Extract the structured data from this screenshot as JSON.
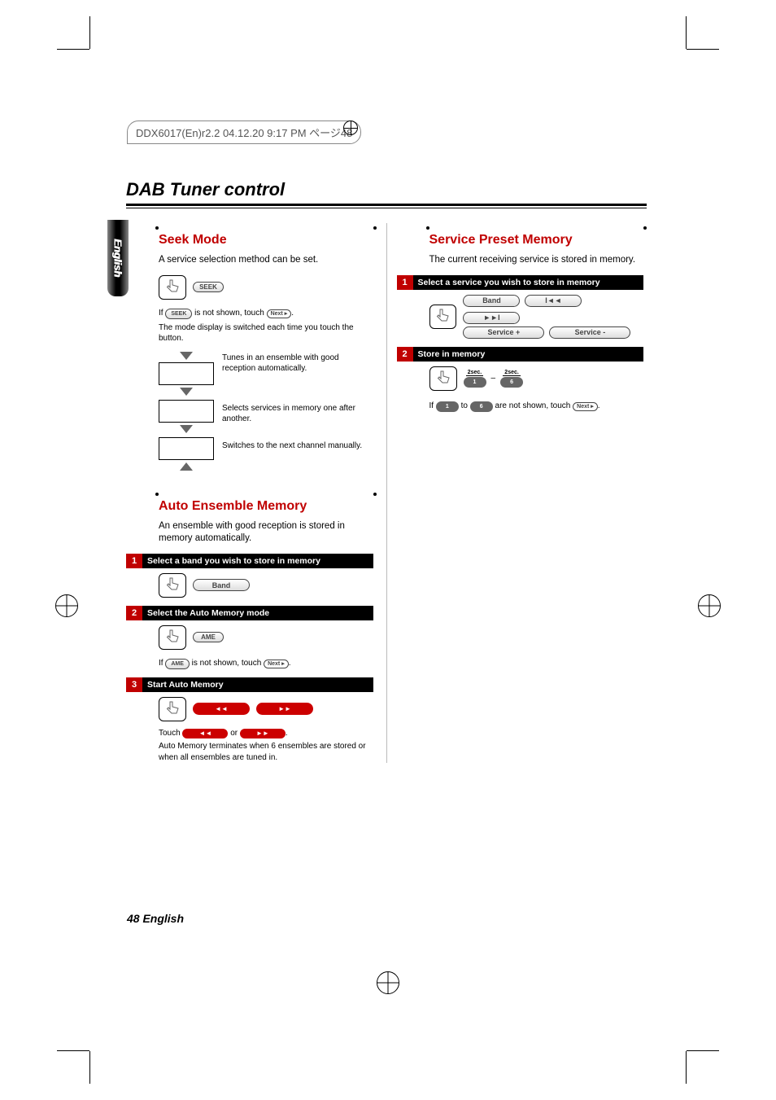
{
  "slugline": "DDX6017(En)r2.2  04.12.20  9:17 PM  ページ48",
  "lang_tab": "English",
  "page_title": "DAB Tuner control",
  "footer": "48 English",
  "seek": {
    "title": "Seek Mode",
    "intro": "A service selection method can be set.",
    "seek_btn": "SEEK",
    "if_prefix": "If ",
    "if_btn1": "SEEK",
    "if_mid": " is not shown, touch ",
    "if_btn2": "Next ▸",
    "if_suffix": ".",
    "switch_text": "The mode display is switched each time you touch the button.",
    "mode1": "Tunes in an ensemble with good reception automatically.",
    "mode2": "Selects services in memory one after another.",
    "mode3": "Switches to the next channel manually."
  },
  "auto": {
    "title": "Auto Ensemble Memory",
    "intro": "An ensemble with good reception is stored in memory automatically.",
    "step1": "Select a band you wish to store in memory",
    "band_btn": "Band",
    "step2": "Select the Auto Memory mode",
    "ame_btn": "AME",
    "if_prefix": "If ",
    "if_btn1": "AME",
    "if_mid": " is not shown, touch ",
    "if_btn2": "Next ▸",
    "if_suffix": ".",
    "step3": "Start Auto Memory",
    "rev_btn": "◄◄",
    "fwd_btn": "►►",
    "touch_prefix": "Touch ",
    "touch_or": " or ",
    "touch_suffix": ".",
    "note": "Auto Memory terminates when 6 ensembles are stored or when all ensembles are tuned in."
  },
  "preset": {
    "title": "Service Preset Memory",
    "intro": "The current receiving service is stored in memory.",
    "step1": "Select a service you wish to store in memory",
    "band_btn": "Band",
    "prev_btn": "I◄◄",
    "next_btn": "►►I",
    "svc_plus": "Service +",
    "svc_minus": "Service -",
    "step2": "Store in memory",
    "sec_label": "2sec.",
    "p1": "1",
    "p6": "6",
    "if_prefix": "If ",
    "if_to": " to ",
    "if_mid": " are not shown, touch ",
    "if_btn": "Next ▸",
    "if_suffix": "."
  }
}
